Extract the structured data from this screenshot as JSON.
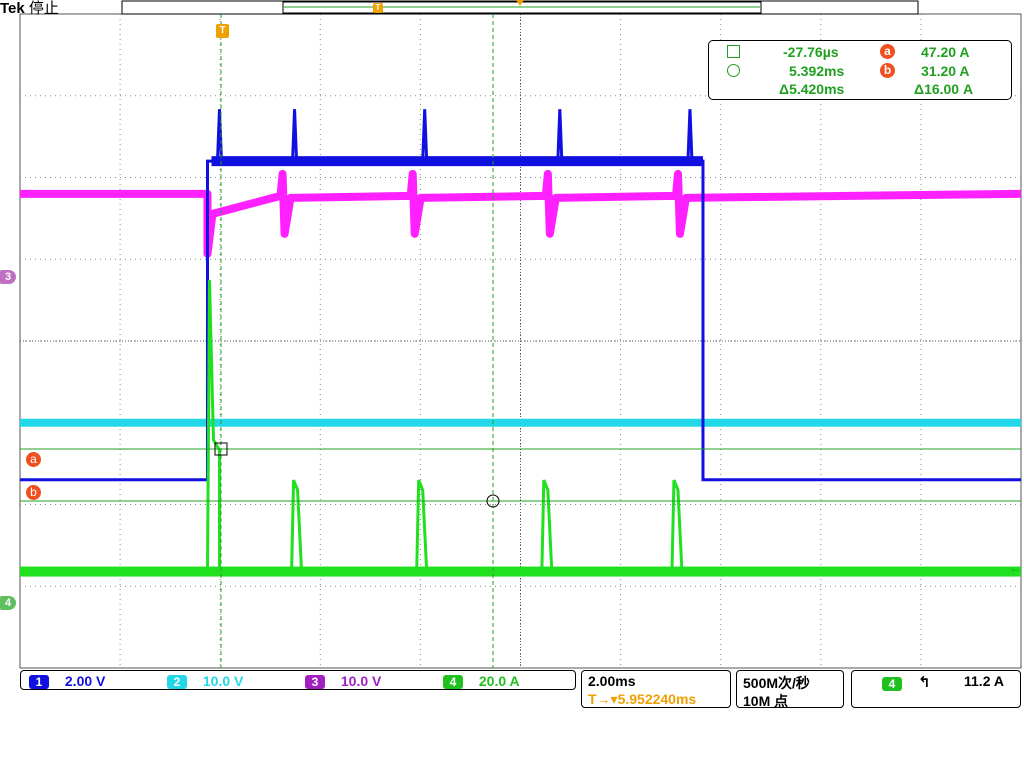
{
  "header": {
    "brand": "Tek",
    "status": "停止",
    "trigger_marker": "T"
  },
  "measurements": {
    "cursor1_time": "-27.76µs",
    "cursor2_time": "5.392ms",
    "delta_time": "Δ5.420ms",
    "cursor_a_label": "a",
    "cursor_a_value": "47.20 A",
    "cursor_b_label": "b",
    "cursor_b_value": "31.20 A",
    "delta_value": "Δ16.00 A"
  },
  "markers": {
    "ch3_marker": "3",
    "ch4_marker": "4",
    "cursor_a": "a",
    "cursor_b": "b"
  },
  "channels": [
    {
      "id": "1",
      "scale": "2.00 V",
      "color": "#1010e0"
    },
    {
      "id": "2",
      "scale": "10.0 V",
      "color": "#22d8e8"
    },
    {
      "id": "3",
      "scale": "10.0 V",
      "color": "#a020c0"
    },
    {
      "id": "4",
      "scale": "20.0 A",
      "color": "#20c020"
    }
  ],
  "timebase": {
    "scale": "2.00ms",
    "trigger_position": "T→▾5.952240ms"
  },
  "acquisition": {
    "sample_rate": "500M次/秒",
    "record_length": "10M 点"
  },
  "trigger": {
    "source": "4",
    "slope_icon": "rising-edge-icon",
    "level": "11.2 A"
  },
  "colors": {
    "ch1": "#1010e0",
    "ch2": "#22d8e8",
    "ch3": "#ff20ff",
    "ch4": "#20e020",
    "cursor": "#20a020",
    "trigger": "#f0a000"
  },
  "chart_data": {
    "type": "line",
    "grid": true,
    "x_divisions": 10,
    "y_divisions": 8,
    "time_per_div_ms": 2.0,
    "series": [
      {
        "name": "1",
        "unit": "V",
        "baseline_div": -1.6,
        "high_div": 2.2,
        "pulse_start_ms": -0.3,
        "pulse_end_ms": 9.6,
        "spikes_ms": [
          -0.3,
          1.2,
          3.8,
          6.5,
          9.1
        ]
      },
      {
        "name": "2",
        "unit": "V",
        "baseline_div": -1.0
      },
      {
        "name": "3",
        "unit": "V",
        "baseline_div": 1.8,
        "dip_at_ms": [
          -0.3,
          1.2,
          3.8,
          6.5,
          9.1
        ]
      },
      {
        "name": "4",
        "unit": "A",
        "baseline_div": -2.6,
        "spike_at_ms": [
          -0.3
        ],
        "pulse_peaks_ms": [
          1.5,
          4.0,
          6.5,
          9.1
        ]
      }
    ],
    "cursors": {
      "a_value": 47.2,
      "b_value": 31.2
    }
  }
}
